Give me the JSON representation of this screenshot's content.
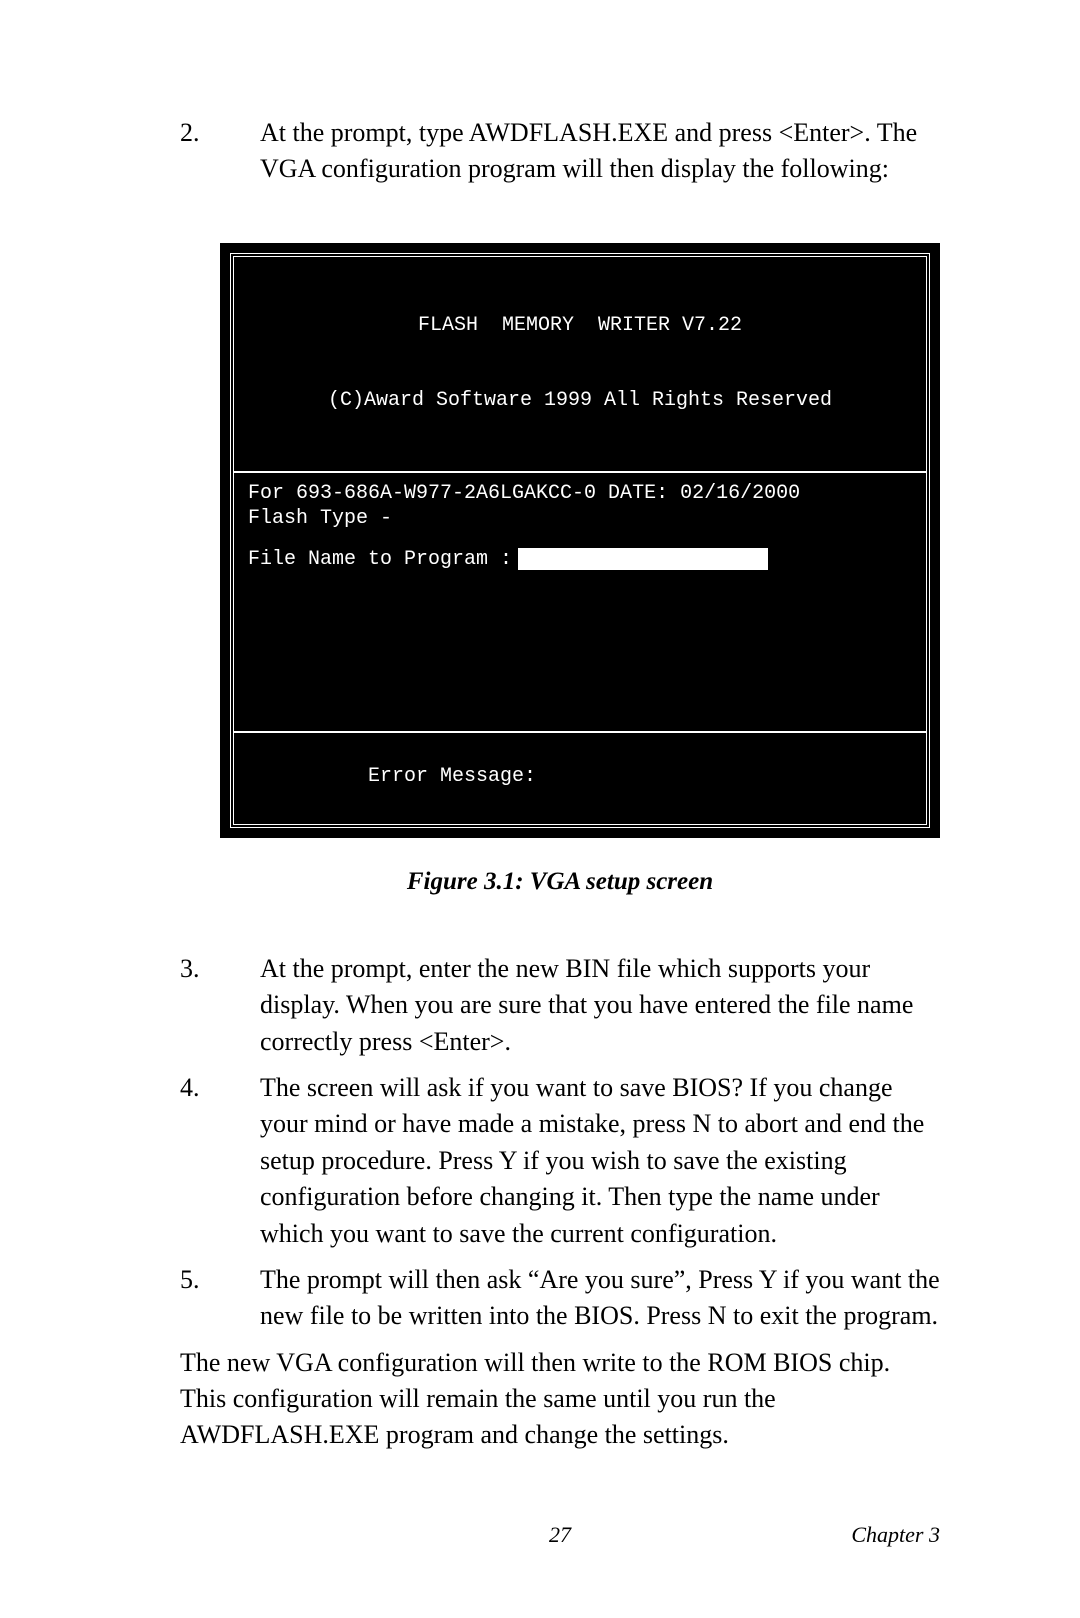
{
  "steps": {
    "s2": {
      "num": "2.",
      "text": "At the prompt, type AWDFLASH.EXE and press <Enter>. The VGA configuration program will then display the following:"
    },
    "s3": {
      "num": "3.",
      "text": "At the prompt, enter the new BIN file which supports your display. When you are sure that you have entered the file name correctly press <Enter>."
    },
    "s4": {
      "num": "4.",
      "text": "The screen will ask if you want to save BIOS? If you change your mind or have made a mistake, press N to abort and end the setup procedure. Press Y if you wish to save the existing configuration before changing it. Then type the name under which you want to save the current configuration."
    },
    "s5": {
      "num": "5.",
      "text": "The prompt will then ask “Are you sure”, Press Y if you want the new file to be written into the BIOS. Press N to exit the program."
    }
  },
  "closing_paragraph": "The new VGA configuration will then write to the ROM BIOS chip. This configuration will remain the same until you run the AWDFLASH.EXE program and change the settings.",
  "bios": {
    "header_line1": "FLASH  MEMORY  WRITER V7.22",
    "header_line2": "(C)Award Software 1999 All Rights Reserved",
    "body_line1": "For 693-686A-W977-2A6LGAKCC-0 DATE: 02/16/2000",
    "body_line2": "Flash Type -",
    "input_label": "File Name to Program :",
    "input_value": "",
    "footer": "Error Message:"
  },
  "figure_caption": "Figure 3.1: VGA setup screen",
  "footer": {
    "page_number": "27",
    "chapter": "Chapter 3"
  }
}
